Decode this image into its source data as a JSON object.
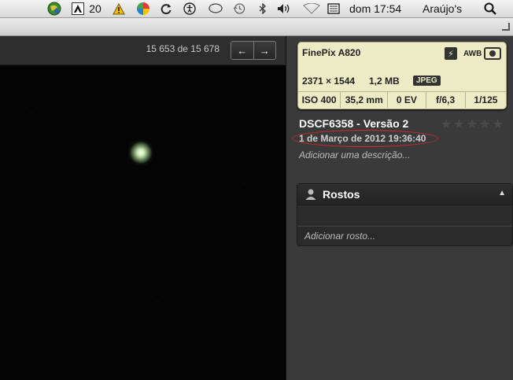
{
  "menubar": {
    "adobe_badge_count": "20",
    "clock": "dom 17:54",
    "user": "Araújo's",
    "icons": [
      "globe-icon",
      "adobe-icon",
      "warning-icon",
      "color-wheel-icon",
      "sync-icon",
      "accessibility-icon",
      "chat-icon",
      "time-machine-icon",
      "bluetooth-icon",
      "volume-icon",
      "wifi-icon",
      "keyboard-icon",
      "search-icon"
    ]
  },
  "viewer": {
    "counter": "15 653 de 15 678",
    "prev_arrow": "←",
    "next_arrow": "→"
  },
  "exif": {
    "camera": "FinePix A820",
    "dimensions": "2371 × 1544",
    "file_size": "1,2 MB",
    "format": "JPEG",
    "flash_icon": "⚡",
    "white_balance": "AWB",
    "iso": "ISO 400",
    "focal_length": "35,2 mm",
    "exposure_bias": "0 EV",
    "aperture": "f/6,3",
    "shutter": "1/125"
  },
  "photo_info": {
    "title": "DSCF6358 - Versão 2",
    "rating_stars": [
      "★",
      "★",
      "★",
      "★",
      "★"
    ],
    "date": "1 de Março de 2012 19:36:40",
    "description_placeholder": "Adicionar uma descrição..."
  },
  "faces": {
    "title": "Rostos",
    "toggle": "▲",
    "add_placeholder": "Adicionar rosto..."
  },
  "colors": {
    "exif_bg": "#ecebc6",
    "highlight_ring": "#d92b2b",
    "panel_bg": "#3a3a3a"
  }
}
